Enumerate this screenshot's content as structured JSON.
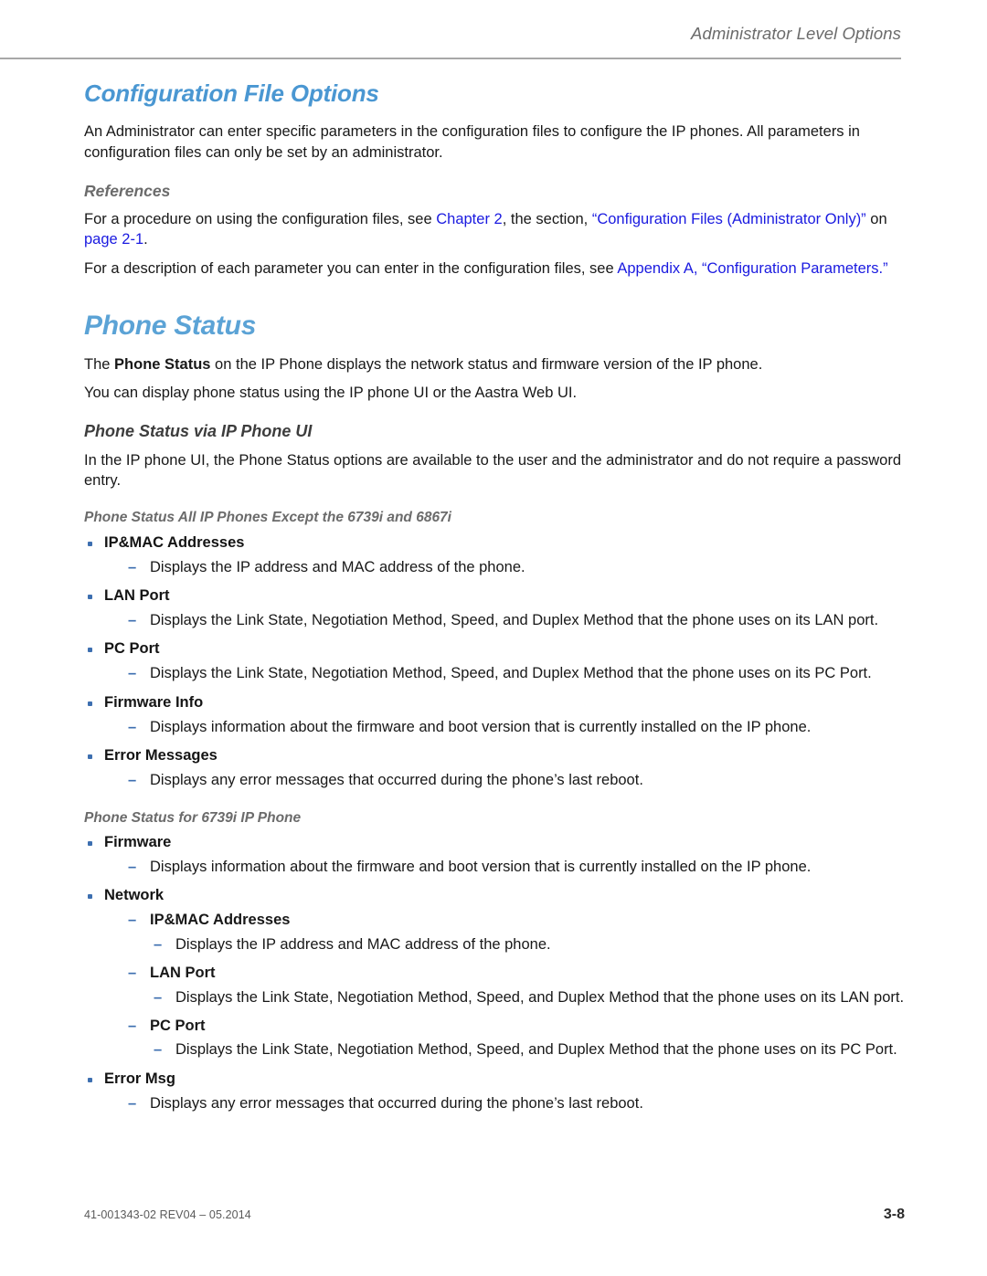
{
  "header": {
    "running_title": "Administrator Level Options"
  },
  "chapter": {
    "title": "Configuration File Options",
    "intro": "An Administrator can enter specific parameters in the configuration files to configure the IP phones. All parameters in configuration files can only be set by an administrator."
  },
  "references": {
    "heading": "References",
    "para1": {
      "t1": "For a procedure on using the configuration files, see ",
      "link1": "Chapter 2",
      "t2": ", the section, ",
      "link2": "“Configuration Files (Administrator Only)”",
      "t3": " on ",
      "link3": "page 2-1",
      "t4": "."
    },
    "para2": {
      "t1": "For a description of each parameter you can enter in the configuration files, see ",
      "link1": "Appendix A, “Configuration Parameters.”"
    }
  },
  "phone_status": {
    "title": "Phone Status",
    "para1": {
      "t1": "The ",
      "bold": "Phone Status",
      "t2": " on the IP Phone displays the network status and firmware version of the IP phone."
    },
    "para2": "You can display phone status using the IP phone UI or the Aastra Web UI.",
    "sub_heading": "Phone Status via IP Phone UI",
    "sub_para": "In the IP phone UI, the Phone Status options are available to the user and the administrator and do not require a password entry.",
    "group_a": {
      "heading": "Phone Status All IP Phones Except the 6739i and 6867i",
      "items": [
        {
          "label": "IP&MAC Addresses",
          "desc": "Displays the IP address and MAC address of the phone."
        },
        {
          "label": "LAN Port",
          "desc": "Displays the Link State, Negotiation Method, Speed, and Duplex Method that the phone uses on its LAN port."
        },
        {
          "label": "PC Port",
          "desc": "Displays the Link State, Negotiation Method, Speed, and Duplex Method that the phone uses on its PC Port."
        },
        {
          "label": "Firmware Info",
          "desc": "Displays information about the firmware and boot version that is currently installed on the IP phone."
        },
        {
          "label": "Error Messages",
          "desc": "Displays any error messages that occurred during the phone’s last reboot."
        }
      ]
    },
    "group_b": {
      "heading": "Phone Status for 6739i IP Phone",
      "firmware": {
        "label": "Firmware",
        "desc": "Displays information about the firmware and boot version that is currently installed on the IP phone."
      },
      "network": {
        "label": "Network",
        "children": [
          {
            "label": "IP&MAC Addresses",
            "desc": "Displays the IP address and MAC address of the phone."
          },
          {
            "label": "LAN Port",
            "desc": "Displays the Link State, Negotiation Method, Speed, and Duplex Method that the phone uses on its LAN port."
          },
          {
            "label": "PC Port",
            "desc": "Displays the Link State, Negotiation Method, Speed, and Duplex Method that the phone uses on its PC Port."
          }
        ]
      },
      "error_msg": {
        "label": "Error Msg",
        "desc": "Displays any error messages that occurred during the phone’s last reboot."
      }
    }
  },
  "footer": {
    "doc_id": "41-001343-02 REV04 – 05.2014",
    "page_number": "3-8"
  },
  "colors": {
    "heading_blue": "#4a97d2",
    "section_blue": "#5ba3d6",
    "link_blue": "#1a1ae0",
    "bullet_blue": "#3d6fb0",
    "subheading_gray": "#6b6b6b",
    "rule_gray": "#a8a8a8"
  }
}
